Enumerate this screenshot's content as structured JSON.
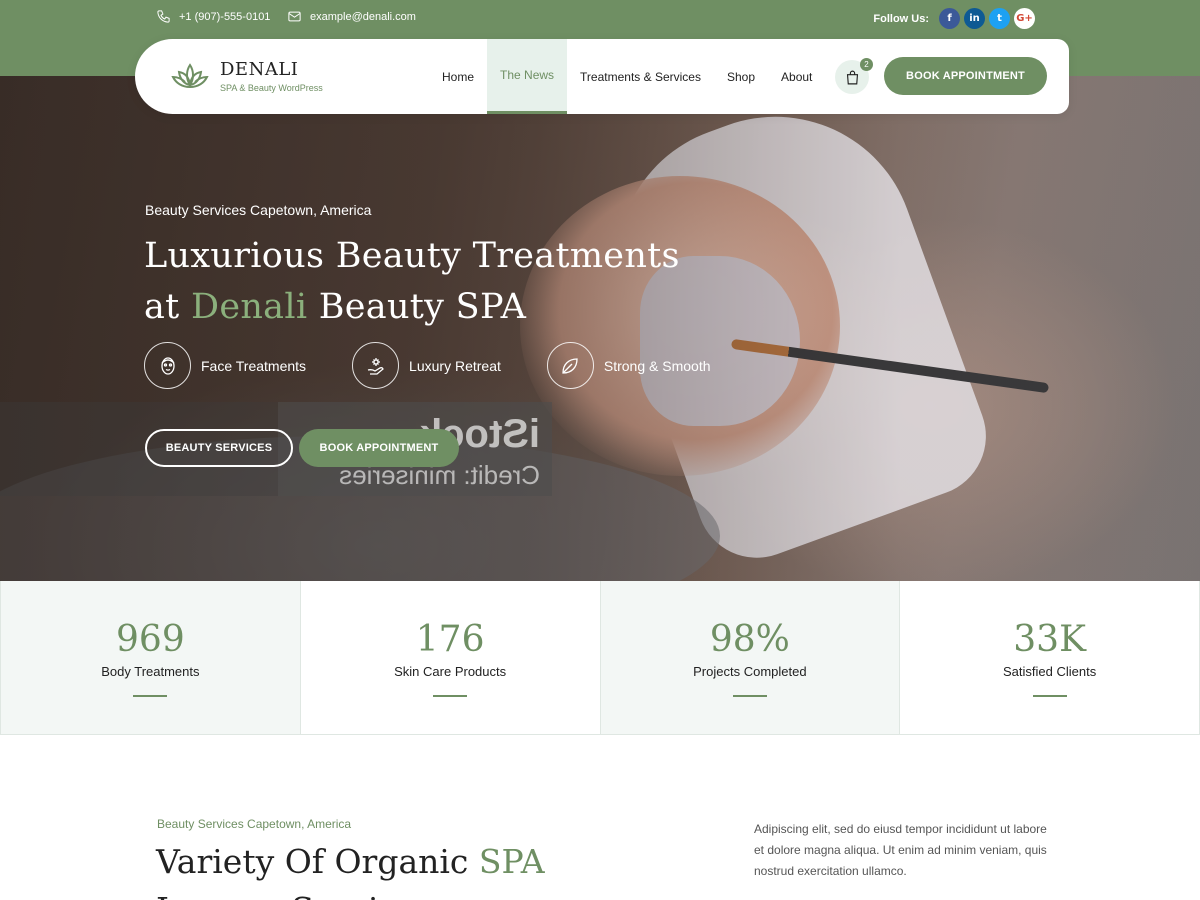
{
  "topbar": {
    "phone": "+1 (907)-555-0101",
    "email": "example@denali.com",
    "follow_label": "Follow Us:",
    "social": [
      {
        "name": "facebook",
        "glyph": "f"
      },
      {
        "name": "linkedin",
        "glyph": "in"
      },
      {
        "name": "twitter",
        "glyph": "t"
      },
      {
        "name": "google-plus",
        "glyph": "G+"
      }
    ]
  },
  "header": {
    "brand_name": "DENALI",
    "brand_tagline": "SPA & Beauty WordPress",
    "nav": [
      "Home",
      "The News",
      "Treatments & Services",
      "Shop",
      "About"
    ],
    "active_nav": "The News",
    "cart_count": "2",
    "book_label": "BOOK APPOINTMENT"
  },
  "hero": {
    "kicker": "Beauty Services Capetown, America",
    "title_line1": "Luxurious Beauty Treatments",
    "title_line2_pre": "at ",
    "title_line2_accent": "Denali",
    "title_line2_post": " Beauty SPA",
    "features": [
      {
        "label": "Face Treatments",
        "icon": "face-icon"
      },
      {
        "label": "Luxury Retreat",
        "icon": "flower-hand-icon"
      },
      {
        "label": "Strong & Smooth",
        "icon": "leaf-icon"
      }
    ],
    "btn_services": "BEAUTY SERVICES",
    "btn_book": "BOOK APPOINTMENT",
    "watermark_top": "iStock",
    "watermark_credit": "Credit: miniseries"
  },
  "stats": [
    {
      "value": "969",
      "label": "Body Treatments"
    },
    {
      "value": "176",
      "label": "Skin Care Products"
    },
    {
      "value": "98%",
      "label": "Projects Completed"
    },
    {
      "value": "33K",
      "label": "Satisfied Clients"
    }
  ],
  "section": {
    "kicker": "Beauty Services Capetown, America",
    "title_pre": "Variety Of Organic ",
    "title_accent": "SPA",
    "title_line2": "Lounge Services",
    "text": "Adipiscing elit, sed do eiusd tempor incididunt ut labore et dolore magna aliqua. Ut enim ad minim veniam, quis nostrud exercitation ullamco."
  },
  "colors": {
    "accent": "#6f8f63",
    "accent_light": "#e7f1eb",
    "title_accent": "#8bb07c"
  }
}
